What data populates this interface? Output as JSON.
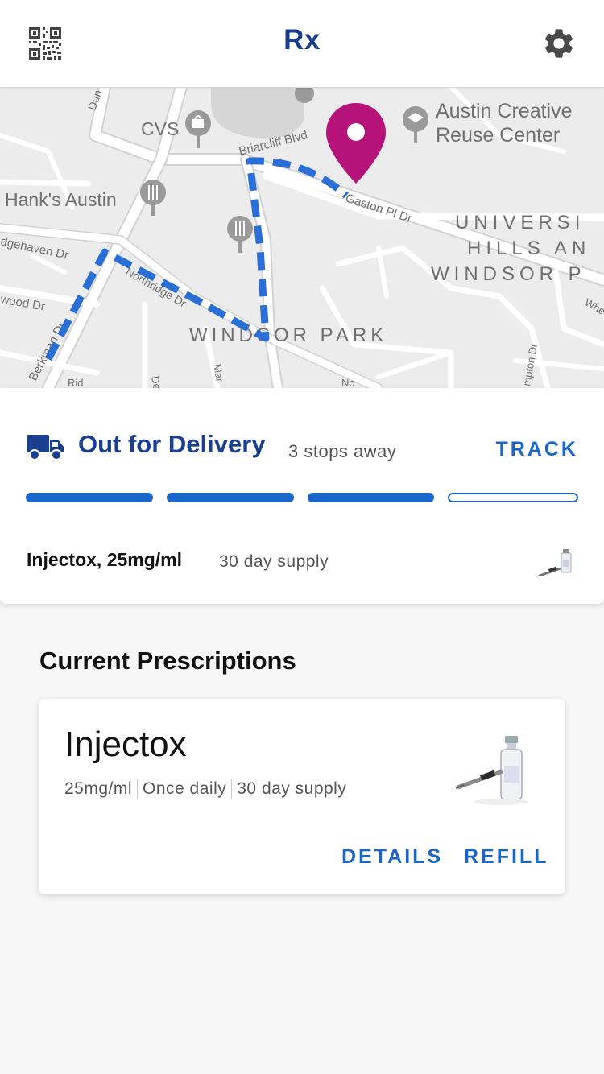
{
  "app": {
    "title": "Rx",
    "left_icon": "qr-code-icon",
    "right_icon": "gear-icon"
  },
  "map": {
    "labels": {
      "cvs": "CVS",
      "austin_creative_1": "Austin Creative",
      "austin_creative_2": "Reuse Center",
      "hanks": "Hank's Austin",
      "briarcliff": "Briarcliff Blvd",
      "gaston": "Gaston Pl Dr",
      "ridgehaven": "dgehaven Dr",
      "ortridge": "Northridge Dr",
      "wood": "wood Dr",
      "berkman": "Berkman Dr",
      "windsor_park": "WINDSOR PARK",
      "univ_1": "UNIVERSI",
      "univ_2": "HILLS AN",
      "univ_3": "WINDSOR P",
      "dun": "Dun",
      "rid": "Rid",
      "del": "Del",
      "mar": "Mar",
      "no": "No",
      "whe": "Whe",
      "hampton": "mpton Dr"
    },
    "pin_color": "#b5137a",
    "route_color": "#2a6fd6"
  },
  "delivery": {
    "status": "Out for Delivery",
    "stops": "3 stops away",
    "track_label": "TRACK",
    "progress_segments": [
      true,
      true,
      true,
      false
    ],
    "item": "Injectox, 25mg/ml",
    "supply": "30 day supply",
    "accent": "#1a66c9",
    "status_color": "#1a3f8f"
  },
  "prescriptions": {
    "section_title": "Current Prescriptions",
    "items": [
      {
        "name": "Injectox",
        "dose": "25mg/ml",
        "frequency": "Once daily",
        "supply": "30 day supply",
        "details_label": "DETAILS",
        "refill_label": "REFILL"
      }
    ]
  }
}
